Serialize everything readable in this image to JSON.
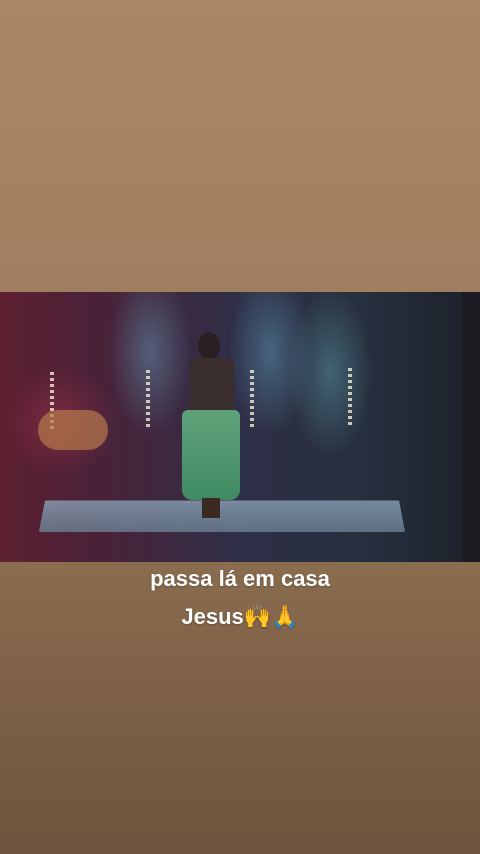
{
  "story": {
    "caption_line1": "passa lá em casa",
    "caption_line2": "Jesus🙌🙏"
  },
  "video": {
    "scene": "stage",
    "accent_colors": [
      "#5c1f30",
      "#6ec8e0",
      "#5fa27a"
    ]
  }
}
